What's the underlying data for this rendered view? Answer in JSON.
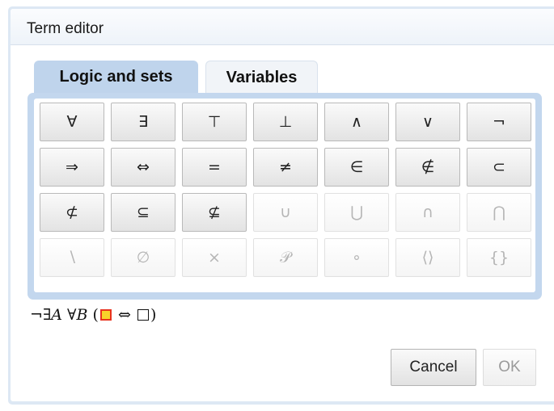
{
  "dialog": {
    "title": "Term editor"
  },
  "tabs": [
    {
      "label": "Logic and sets",
      "active": true
    },
    {
      "label": "Variables",
      "active": false
    }
  ],
  "symbols": [
    {
      "symbol": "∀",
      "name": "forall",
      "enabled": true
    },
    {
      "symbol": "∃",
      "name": "exists",
      "enabled": true
    },
    {
      "symbol": "⊤",
      "name": "top",
      "enabled": true
    },
    {
      "symbol": "⊥",
      "name": "bottom",
      "enabled": true
    },
    {
      "symbol": "∧",
      "name": "and",
      "enabled": true
    },
    {
      "symbol": "∨",
      "name": "or",
      "enabled": true
    },
    {
      "symbol": "¬",
      "name": "not",
      "enabled": true
    },
    {
      "symbol": "⇒",
      "name": "implies",
      "enabled": true
    },
    {
      "symbol": "⇔",
      "name": "iff",
      "enabled": true
    },
    {
      "symbol": "=",
      "name": "equals",
      "enabled": true
    },
    {
      "symbol": "≠",
      "name": "not-equals",
      "enabled": true
    },
    {
      "symbol": "∈",
      "name": "element-of",
      "enabled": true
    },
    {
      "symbol": "∉",
      "name": "not-element-of",
      "enabled": true
    },
    {
      "symbol": "⊂",
      "name": "subset",
      "enabled": true
    },
    {
      "symbol": "⊄",
      "name": "not-subset",
      "enabled": true
    },
    {
      "symbol": "⊆",
      "name": "subset-eq",
      "enabled": true
    },
    {
      "symbol": "⊈",
      "name": "not-subset-eq",
      "enabled": true
    },
    {
      "symbol": "∪",
      "name": "union",
      "enabled": false
    },
    {
      "symbol": "⋃",
      "name": "big-union",
      "enabled": false
    },
    {
      "symbol": "∩",
      "name": "intersection",
      "enabled": false
    },
    {
      "symbol": "⋂",
      "name": "big-intersection",
      "enabled": false
    },
    {
      "symbol": "∖",
      "name": "set-minus",
      "enabled": false
    },
    {
      "symbol": "∅",
      "name": "empty-set",
      "enabled": false
    },
    {
      "symbol": "×",
      "name": "cartesian-product",
      "enabled": false
    },
    {
      "symbol": "𝒫",
      "name": "power-set",
      "enabled": false
    },
    {
      "symbol": "∘",
      "name": "composition",
      "enabled": false
    },
    {
      "symbol": "⟨⟩",
      "name": "tuple",
      "enabled": false
    },
    {
      "symbol": "{}",
      "name": "set-braces",
      "enabled": false
    }
  ],
  "term": {
    "not": "¬",
    "exists": "∃",
    "var_a": "A",
    "forall": "∀",
    "var_b": "B",
    "open_paren": "(",
    "iff": "⇔",
    "close_paren": ")",
    "placeholder_selected_color": "#f8d22a",
    "placeholder_selected_border": "#e8321e"
  },
  "footer": {
    "cancel_label": "Cancel",
    "ok_label": "OK",
    "ok_enabled": false
  }
}
